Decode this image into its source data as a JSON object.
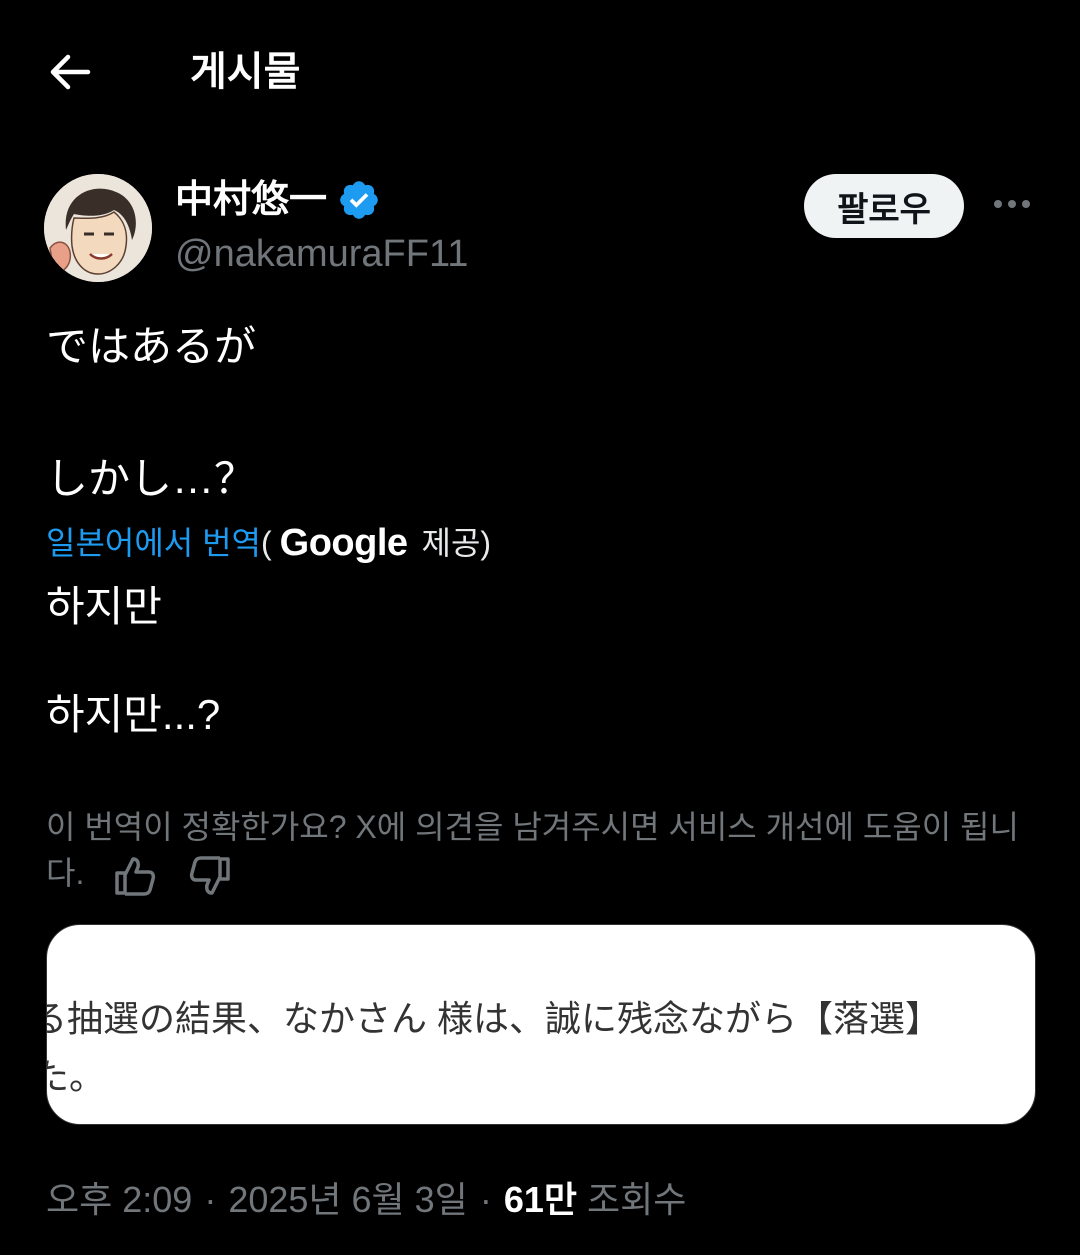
{
  "header": {
    "title": "게시물"
  },
  "author": {
    "display_name": "中村悠一",
    "handle": "@nakamuraFF11",
    "follow_label": "팔로우"
  },
  "tweet": {
    "line1": "ではあるが",
    "line2": "しかし…？"
  },
  "translation": {
    "link_label": "일본어에서 번역",
    "open_paren": "(",
    "provider": "Google",
    "provided_label": "제공)",
    "line1": "하지만",
    "line2": "하지만...?",
    "feedback_text": "이 번역이 정확한가요? X에 의견을 남겨주시면 서비스 개선에 도움이 됩니다."
  },
  "media": {
    "line1": "る抽選の結果、なかさん 様は、誠に残念ながら【落選】",
    "line2": "た。"
  },
  "meta": {
    "time": "오후 2:09",
    "separator": "·",
    "date": "2025년 6월 3일",
    "views_count": "61만",
    "views_label": "조회수"
  },
  "colors": {
    "background": "#000000",
    "link": "#1d9bf0",
    "verified": "#1d9bf0",
    "muted": "#71767b"
  }
}
